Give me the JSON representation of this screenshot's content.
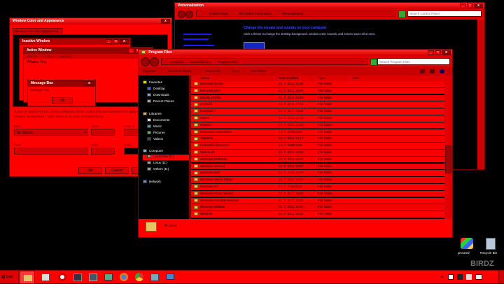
{
  "colors": {
    "chrome": "#ff0000",
    "chrome_dark": "#7a0000",
    "workspace": "#000000",
    "accent_text": "#ff2d2d",
    "folder": "#e6c466"
  },
  "win_color": {
    "title": "Window Color and Appearance",
    "tab": "Window Color and Appearance",
    "inactive_title": "Inactive Window",
    "active_title": "Active Window",
    "menu": [
      "Normal",
      "Disabled",
      "Selected"
    ],
    "window_text": "Window Text",
    "msgbox_title": "Message Box",
    "msgbox_text": "Message Text",
    "ok": "OK",
    "info": "To turn on Windows Basic, select a Windows theme. Colors and sizes selected here apply only if you have selected the Windows 7 Basic theme or an Ease of Access theme.",
    "item_label": "Item:",
    "item_value": "3D Objects",
    "size_label": "Size:",
    "color1_label": "Color 1:",
    "color2_label": "Color 2:",
    "font_label": "Font:",
    "fsize_label": "Size:",
    "fcolor_label": "Color:",
    "ok_button": "OK",
    "cancel_button": "Cancel",
    "apply_button": "Apply"
  },
  "personalization": {
    "title": "Personalization",
    "crumbs": [
      "Control Panel",
      "All Control Panel Items",
      "Personalization"
    ],
    "search_placeholder": "Search Control Panel",
    "heading": "Change the visuals and sounds on your computer",
    "subheading": "Click a theme to change the desktop background, window color, sounds, and screen saver all at once."
  },
  "explorer": {
    "title": "Program Files",
    "crumbs": [
      "Computer",
      "Local Disk (C:)",
      "Program Files"
    ],
    "search_placeholder": "Search Program Files",
    "toolbar": [
      "Organize",
      "Include in library",
      "Share with",
      "Burn",
      "New folder"
    ],
    "columns": [
      "Name",
      "Date modified",
      "Type",
      "Size"
    ],
    "nav": {
      "favorites_header": "Favorites",
      "favorites": [
        "Desktop",
        "Downloads",
        "Recent Places"
      ],
      "libraries_header": "Libraries",
      "libraries": [
        "Documents",
        "Music",
        "Pictures",
        "Videos"
      ],
      "computer_header": "Computer",
      "computer": [
        "Local Disk (C:)",
        "Linux (D:)",
        "Others (E:)"
      ],
      "network": "Network"
    },
    "rows": [
      {
        "name": "Microsoft Works",
        "date": "21. 7. 2011 13:39",
        "type": "File folder"
      },
      {
        "name": "Microsoft.NET",
        "date": "21. 7. 2011 18:09",
        "type": "File folder"
      },
      {
        "name": "Mozilla Firefox",
        "date": "21. 7. 2011 13:59",
        "type": "File folder"
      },
      {
        "name": "MSBuild",
        "date": "21. 7. 2011 17:51",
        "type": "File folder"
      },
      {
        "name": "Notepad++",
        "date": "21. 7. 2011 19:03",
        "type": "File folder"
      },
      {
        "name": "Opera",
        "date": "21. 7. 2011 13:45",
        "type": "File folder"
      },
      {
        "name": "Realtek",
        "date": "21. 7. 2011 12:06",
        "type": "File folder"
      },
      {
        "name": "Reference Assemblies",
        "date": "14. 7. 2009 6:52",
        "type": "File folder"
      },
      {
        "name": "Tobalcnd",
        "date": "21. 7. 2011 14:17",
        "type": "File folder"
      },
      {
        "name": "Uninstall Information",
        "date": "14. 7. 2009 6:53",
        "type": "File folder"
      },
      {
        "name": "VideoLAN",
        "date": "21. 7. 2011 13:08",
        "type": "File folder"
      },
      {
        "name": "Windows Defender",
        "date": "21. 7. 2011 16:07",
        "type": "File folder"
      },
      {
        "name": "Windows Journal",
        "date": "21. 7. 2011 16:07",
        "type": "File folder"
      },
      {
        "name": "Windows Mail",
        "date": "21. 7. 2011 16:07",
        "type": "File folder"
      },
      {
        "name": "Windows Media Player",
        "date": "21. 7. 2011 16:07",
        "type": "File folder"
      },
      {
        "name": "Windows NT",
        "date": "14. 7. 2009 6:52",
        "type": "File folder"
      },
      {
        "name": "Windows Photo Viewer",
        "date": "21. 7. 2011 16:07",
        "type": "File folder"
      },
      {
        "name": "Windows Portable Devices",
        "date": "21. 7. 2011 16:07",
        "type": "File folder"
      },
      {
        "name": "Windows Sidebar",
        "date": "21. 7. 2011 16:07",
        "type": "File folder"
      },
      {
        "name": "WinRAR",
        "date": "21. 7. 2011 13:31",
        "type": "File folder"
      }
    ],
    "status": "46 items"
  },
  "desktop": {
    "icon1_label": "proceed",
    "icon2_label": "Recycle Bin",
    "watermark": "BIRDZ"
  },
  "taskbar": {
    "start": "Start",
    "apps": [
      "explorer-icon",
      "media-icon",
      "headphones-icon",
      "taskmgr-icon",
      "network-icon",
      "firefox-icon",
      "chrome-icon",
      "controlpanel-icon",
      "display-icon"
    ],
    "tray": [
      "arrow-up-icon",
      "flag-icon",
      "volume-icon",
      "network-tray-icon",
      "keyboard-icon"
    ]
  }
}
